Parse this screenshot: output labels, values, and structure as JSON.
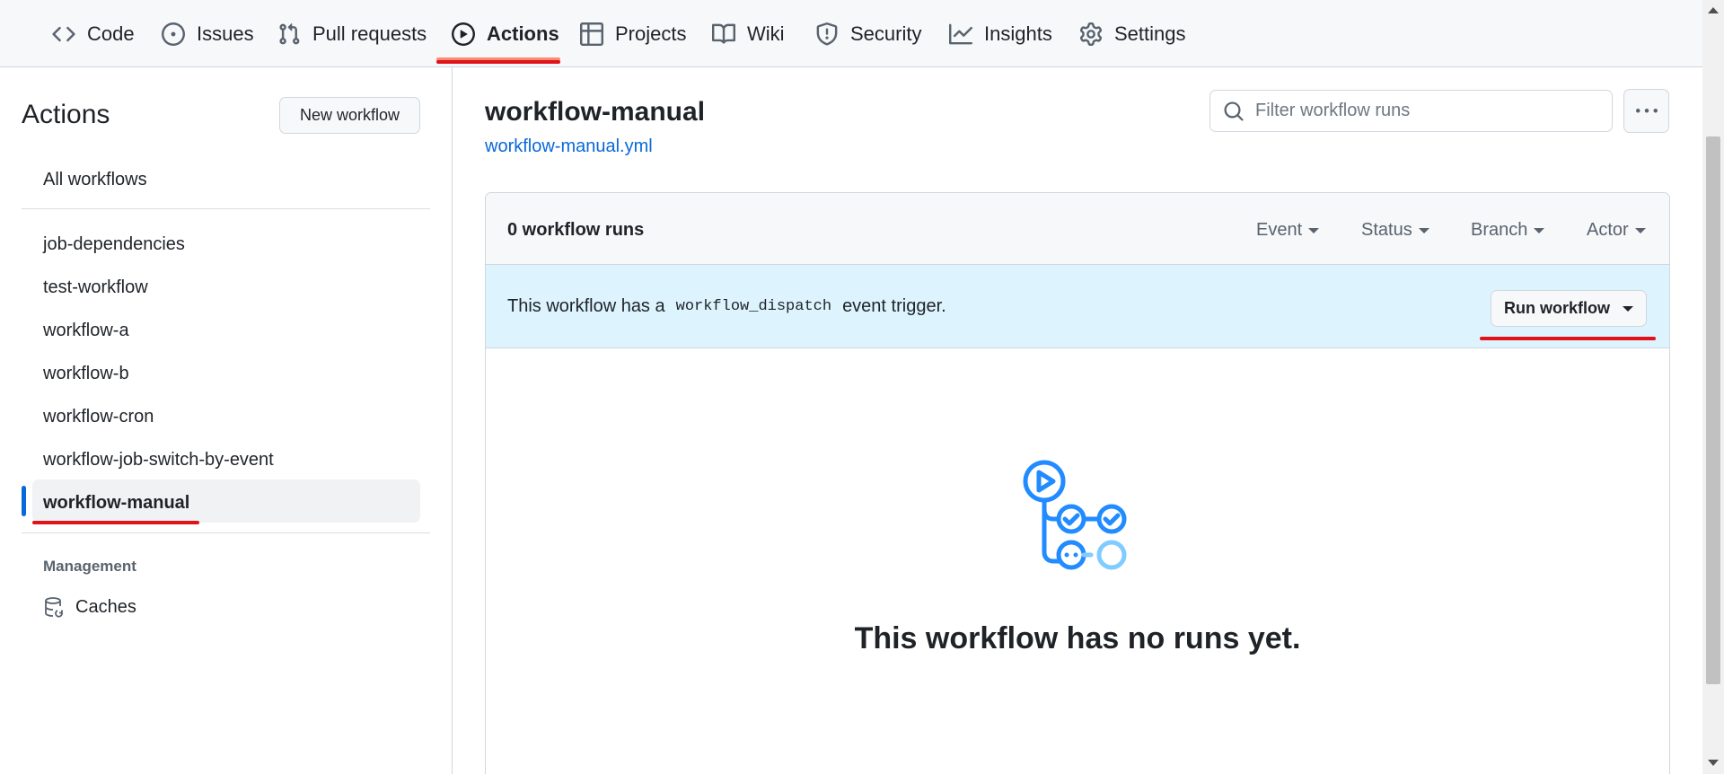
{
  "nav": {
    "items": [
      {
        "label": "Code",
        "icon": "code-icon"
      },
      {
        "label": "Issues",
        "icon": "issue-icon"
      },
      {
        "label": "Pull requests",
        "icon": "pull-request-icon"
      },
      {
        "label": "Actions",
        "icon": "play-icon",
        "selected": true
      },
      {
        "label": "Projects",
        "icon": "table-icon"
      },
      {
        "label": "Wiki",
        "icon": "book-icon"
      },
      {
        "label": "Security",
        "icon": "shield-icon"
      },
      {
        "label": "Insights",
        "icon": "graph-icon"
      },
      {
        "label": "Settings",
        "icon": "gear-icon"
      }
    ]
  },
  "sidebar": {
    "title": "Actions",
    "new_workflow_label": "New workflow",
    "all_workflows_label": "All workflows",
    "workflows": [
      "job-dependencies",
      "test-workflow",
      "workflow-a",
      "workflow-b",
      "workflow-cron",
      "workflow-job-switch-by-event",
      "workflow-manual"
    ],
    "selected_workflow": "workflow-manual",
    "management_heading": "Management",
    "caches_label": "Caches",
    "caches_icon": "database-icon"
  },
  "main": {
    "title": "workflow-manual",
    "file_link": "workflow-manual.yml",
    "filter_placeholder": "Filter workflow runs",
    "more_icon": "kebab-horizontal-icon",
    "runs_count": "0 workflow runs",
    "filters": [
      "Event",
      "Status",
      "Branch",
      "Actor"
    ],
    "dispatch_prefix": "This workflow has a",
    "dispatch_code": "workflow_dispatch",
    "dispatch_suffix": "event trigger.",
    "run_workflow_label": "Run workflow",
    "empty_icon": "workflow-illustration-icon",
    "empty_title": "This workflow has no runs yet."
  },
  "colors": {
    "accent": "#0969da",
    "nav_underline": "#fd8c73",
    "annotation_red": "#e0131b",
    "dispatch_banner": "#ddf4ff"
  }
}
